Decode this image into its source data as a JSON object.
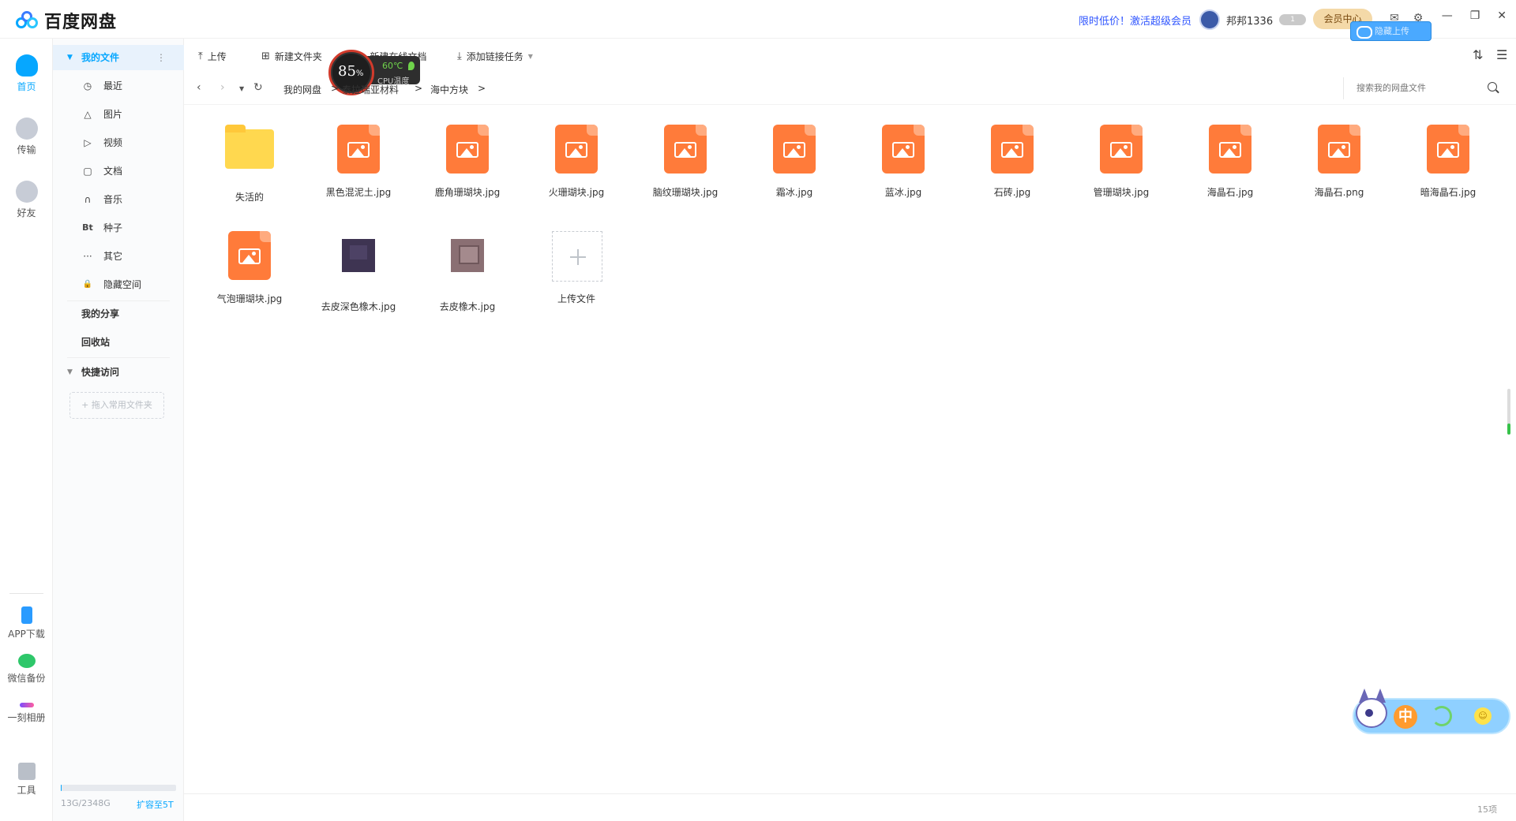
{
  "app": {
    "title": "百度网盘"
  },
  "topbar": {
    "promo": "限时低价！激活超级会员",
    "username": "邦邦1336",
    "level_badge": "1",
    "vip_label": "会员中心",
    "cloud_chip": "隐藏上传",
    "icons": [
      "mail-icon",
      "gear-icon"
    ],
    "window_controls": [
      "—",
      "❐",
      "✕"
    ]
  },
  "rail": {
    "items": [
      {
        "label": "首页",
        "icon": "cloud-icon",
        "active": true
      },
      {
        "label": "传输",
        "icon": "transfer-icon",
        "active": false
      },
      {
        "label": "好友",
        "icon": "friends-icon",
        "active": false
      }
    ],
    "bottom": [
      {
        "label": "APP下载",
        "icon": "phone-icon"
      },
      {
        "label": "微信备份",
        "icon": "wechat-icon"
      },
      {
        "label": "一刻相册",
        "icon": "album-icon"
      },
      {
        "label": "工具",
        "icon": "tools-icon"
      }
    ]
  },
  "sidebar": {
    "my_files": "我的文件",
    "items": [
      {
        "label": "最近",
        "glyph": "◷"
      },
      {
        "label": "图片",
        "glyph": "△"
      },
      {
        "label": "视频",
        "glyph": "▷"
      },
      {
        "label": "文档",
        "glyph": "▢"
      },
      {
        "label": "音乐",
        "glyph": "∩"
      },
      {
        "label": "种子",
        "glyph": "Bt"
      },
      {
        "label": "其它",
        "glyph": "···"
      },
      {
        "label": "隐藏空间",
        "glyph": "🔒"
      }
    ],
    "my_share": "我的分享",
    "recycle": "回收站",
    "quick_access": "快捷访问",
    "drop_hint": "+ 拖入常用文件夹",
    "quota_text": "13G/2348G",
    "quota_fraction": 0.01,
    "quota_link": "扩容至5T"
  },
  "toolbar": {
    "upload": "上传",
    "new_folder": "新建文件夹",
    "new_doc": "新建在线文档",
    "add_link": "添加链接任务"
  },
  "cpu_widget": {
    "percent": "85",
    "percent_unit": "%",
    "temp": "60℃",
    "label": "CPU温度"
  },
  "breadcrumb": {
    "items": [
      "我的网盘",
      "泰拉瑞亚材料",
      "海中方块"
    ],
    "separator": ">"
  },
  "search": {
    "placeholder": "搜索我的网盘文件"
  },
  "files": [
    {
      "name": "失活的",
      "type": "folder"
    },
    {
      "name": "黑色混泥土.jpg",
      "type": "image"
    },
    {
      "name": "鹿角珊瑚块.jpg",
      "type": "image"
    },
    {
      "name": "火珊瑚块.jpg",
      "type": "image"
    },
    {
      "name": "脑纹珊瑚块.jpg",
      "type": "image"
    },
    {
      "name": "霜冰.jpg",
      "type": "image"
    },
    {
      "name": "蓝冰.jpg",
      "type": "image"
    },
    {
      "name": "石砖.jpg",
      "type": "image"
    },
    {
      "name": "管珊瑚块.jpg",
      "type": "image"
    },
    {
      "name": "海晶石.jpg",
      "type": "image"
    },
    {
      "name": "海晶石.png",
      "type": "image"
    },
    {
      "name": "暗海晶石.jpg",
      "type": "image"
    },
    {
      "name": "气泡珊瑚块.jpg",
      "type": "image"
    },
    {
      "name": "去皮深色橡木.jpg",
      "type": "photo-dark"
    },
    {
      "name": "去皮橡木.jpg",
      "type": "photo-light"
    },
    {
      "name": "上传文件",
      "type": "upload"
    }
  ],
  "footer": {
    "count": "15项"
  },
  "ime": {
    "zh": "中",
    "emoji": "☺"
  }
}
